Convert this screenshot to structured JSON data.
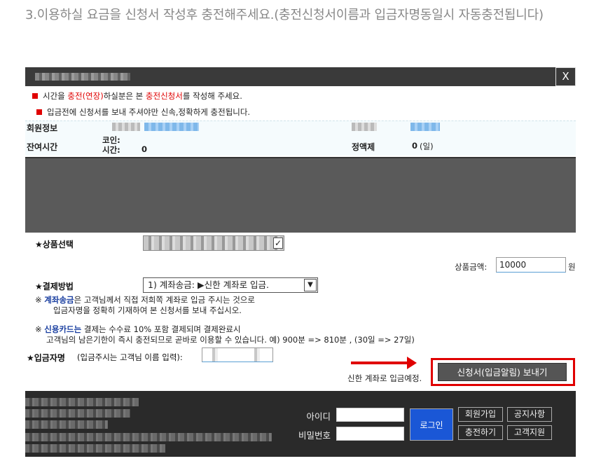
{
  "heading": "3.이용하실 요금을 신청서 작성후 충전해주세요.(충전신청서이름과 입금자명동일시 자동충전됩니다)",
  "dialog": {
    "close_label": "X",
    "notice1": {
      "pre": "시간을 ",
      "red1": "충전(연장)",
      "mid": "하실분은  본  ",
      "red2": "충전신청서",
      "post": "를 작성해 주세요."
    },
    "notice2": "입금전에 신청서를 보내 주셔야만 신속,정확하게 충전됩니다.",
    "member": {
      "info_label": "회원정보",
      "remain_label": "잔여시간",
      "coin_label": "코인:",
      "time_label": "시간:",
      "time_value": "0",
      "plan_label": "정액제",
      "plan_value": "0",
      "plan_unit": "(일)"
    },
    "product_label": "★상품선택",
    "product_check": "✓",
    "price_label": "상품금액:",
    "price_value": "10000",
    "price_unit": "원",
    "pay_label": "★결제방법",
    "pay_selected": "1) 계좌송금: ▶신한 계좌로 입금.",
    "pay_arrow": "▼",
    "desc1": {
      "mark": "※ ",
      "bold": "계좌송금",
      "text": "은 고객님께서  직접 저희쪽 계좌로 입금 주시는 것으로"
    },
    "desc1b": "입금자명을 정확히 기재하여   본  신청서를  보내 주십시오.",
    "desc2": {
      "mark": "※ ",
      "bold": "신용카드는",
      "text": " 결제는 수수료 10% 포함 결제되며 결제완료시"
    },
    "desc2b": "고객님의 남은기한이 즉시 충전되므로 곧바로 이용할 수 있습니다. 예) 900분 => 810분 , (30일 => 27일)",
    "depositor_label": "★입금자명",
    "depositor_hint": "(입금주시는 고객님 이름 입력):",
    "send_label": "신청서(입금알림) 보내기",
    "send_note": "신한 계좌로 입금예정."
  },
  "footer": {
    "id_label": "아이디",
    "pw_label": "비밀번호",
    "login_label": "로그인",
    "join_label": "회원가입",
    "notice_label": "공지사항",
    "charge_label": "충전하기",
    "support_label": "고객지원"
  },
  "colors": {
    "accent_red": "#e00000",
    "login_blue": "#1a57d6",
    "value_purple": "#8a2a8a"
  }
}
